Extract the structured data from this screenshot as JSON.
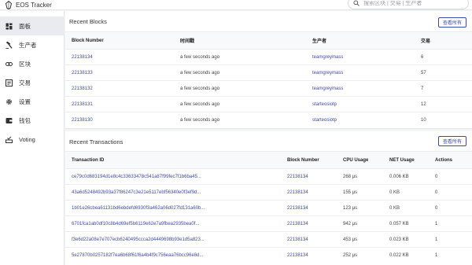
{
  "app": {
    "title": "EOS Tracker"
  },
  "search": {
    "placeholder": "搜索区块 | 交易 | 生产者"
  },
  "sidebar": {
    "items": [
      {
        "label": "面板",
        "icon": "dashboard-icon",
        "active": true
      },
      {
        "label": "生产者",
        "icon": "hammer-icon"
      },
      {
        "label": "区块",
        "icon": "link-icon"
      },
      {
        "label": "交易",
        "icon": "list-icon"
      },
      {
        "label": "设置",
        "icon": "gear-icon"
      },
      {
        "label": "钱包",
        "icon": "wallet-icon"
      },
      {
        "label": "Voting",
        "icon": "ballot-icon"
      }
    ]
  },
  "blocks": {
    "title": "Recent Blocks",
    "view_all": "查看所有",
    "columns": [
      "Block Number",
      "时间戳",
      "生产者",
      "交易"
    ],
    "rows": [
      {
        "number": "22138134",
        "time": "a few seconds ago",
        "producer": "teamgreymass",
        "tx": "6"
      },
      {
        "number": "22138133",
        "time": "a few seconds ago",
        "producer": "teamgreymass",
        "tx": "57"
      },
      {
        "number": "22138132",
        "time": "a few seconds ago",
        "producer": "teamgreymass",
        "tx": "7"
      },
      {
        "number": "22138131",
        "time": "a few seconds ago",
        "producer": "starteosiotp",
        "tx": "12"
      },
      {
        "number": "22138130",
        "time": "a few seconds ago",
        "producer": "starteosiotp",
        "tx": "10"
      }
    ]
  },
  "transactions": {
    "title": "Recent Transactions",
    "view_all": "查看所有",
    "columns": [
      "Transaction ID",
      "Block Number",
      "CPU Usage",
      "NET Usage",
      "Actions"
    ],
    "rows": [
      {
        "id": "ce79c0d683194d1e8c4c33633478c541a87f99fec7f1b6ba45...",
        "block": "22138134",
        "cpu": "268 μs",
        "net": "0.006 KB",
        "actions": "0"
      },
      {
        "id": "43a6d5248492b93a37f86247c3e21e5117ebf56340e0f3ef9d...",
        "block": "22138134",
        "cpu": "155 μs",
        "net": "0 KB",
        "actions": "0"
      },
      {
        "id": "1b01e26cbea61131bd6ebdefd6930f3a462a06d027fd131a60b...",
        "block": "22138134",
        "cpu": "123 μs",
        "net": "0 KB",
        "actions": "0"
      },
      {
        "id": "6701fca1ab0df10c8b4d69ef5b6119e62e7a9fbea2935bea0f...",
        "block": "22138134",
        "cpu": "942 μs",
        "net": "0.057 KB",
        "actions": "1"
      },
      {
        "id": "f3e6d22a08e7e707ecb6240495ccca2d4449698b93e1d5a823...",
        "block": "22138134",
        "cpu": "453 μs",
        "net": "0.023 KB",
        "actions": "1"
      },
      {
        "id": "5e27870b0257182f7ea6b68f61f6a4b4f9c756eaa76bcc96e8d...",
        "block": "22138134",
        "cpu": "252 μs",
        "net": "0.022 KB",
        "actions": "1"
      }
    ]
  }
}
